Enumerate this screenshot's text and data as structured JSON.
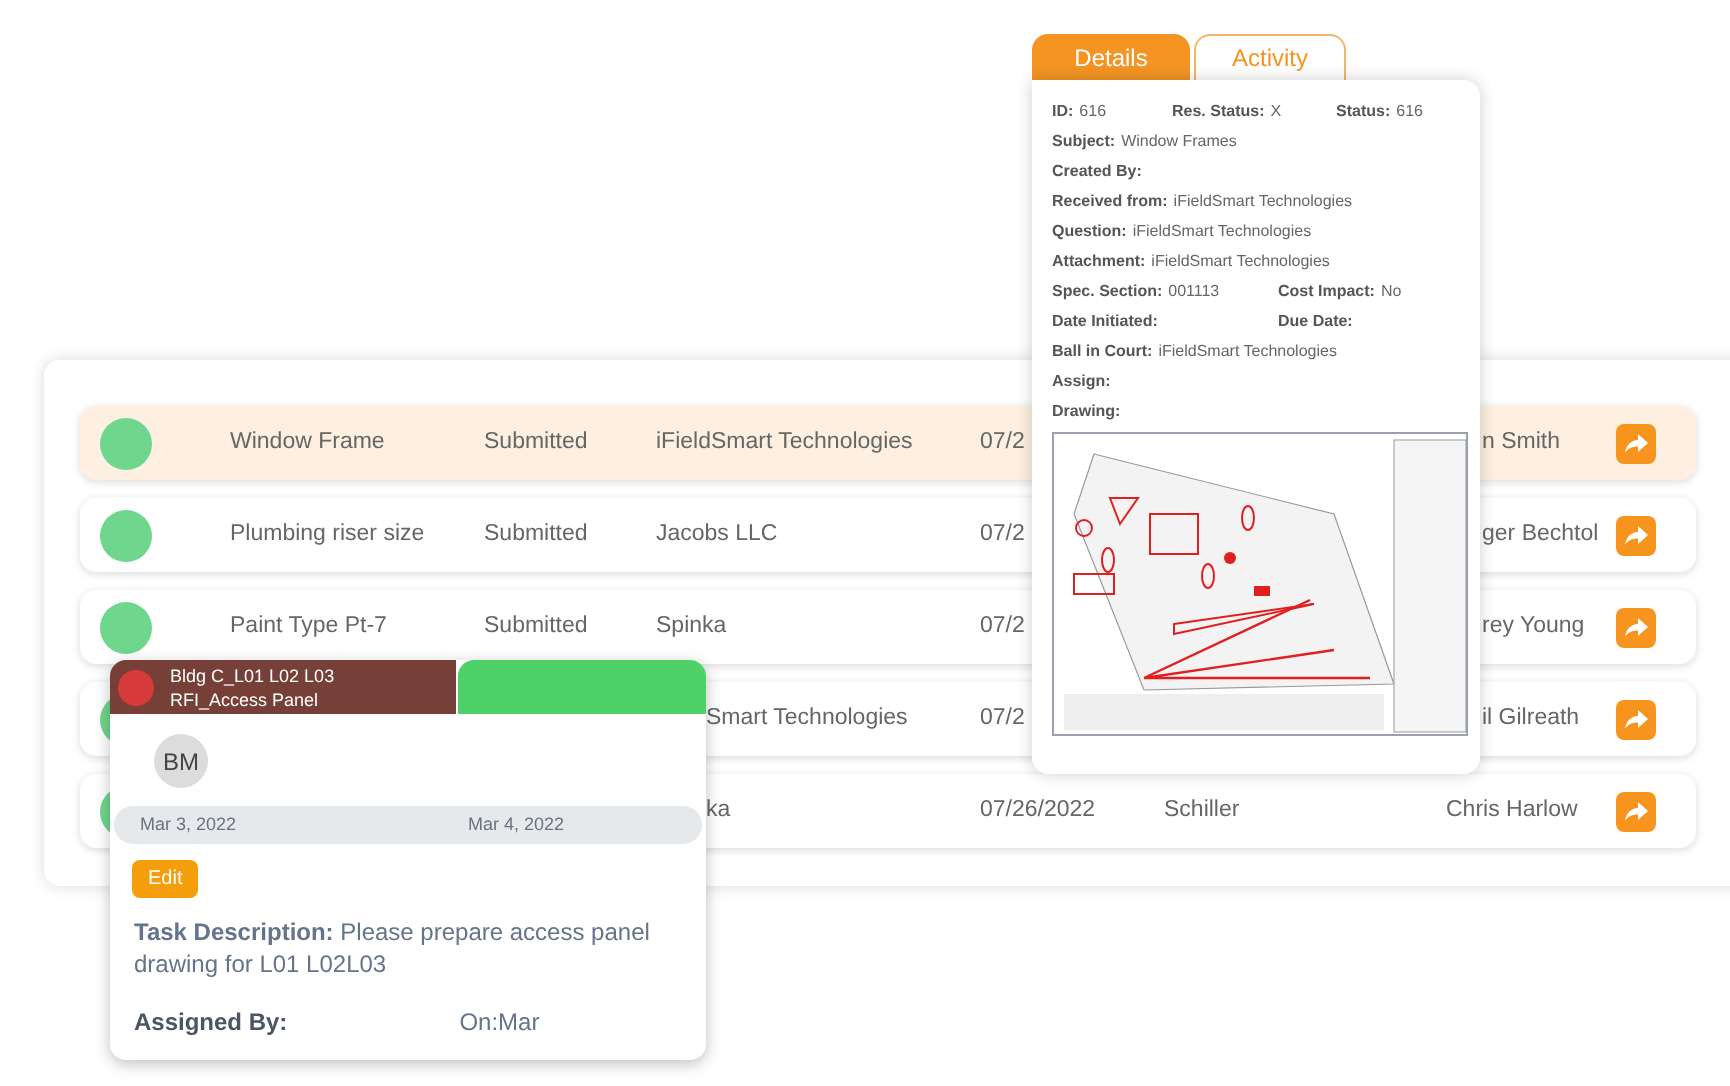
{
  "rows": [
    {
      "highlighted": true,
      "subject": {
        "text": "Window Frame"
      },
      "status": {
        "text": "Submitted"
      },
      "company": {
        "text": "iFieldSmart Technologies"
      },
      "date": {
        "text": "07/2"
      },
      "person": {
        "text": "n Smith",
        "cut_start": true
      }
    },
    {
      "highlighted": false,
      "subject": {
        "text": "Plumbing riser size"
      },
      "status": {
        "text": "Submitted"
      },
      "company": {
        "text": "Jacobs LLC"
      },
      "date": {
        "text": "07/2"
      },
      "person": {
        "text": "ger Bechtol",
        "cut_start": true
      }
    },
    {
      "highlighted": false,
      "subject": {
        "text": "Paint Type Pt-7"
      },
      "status": {
        "text": "Submitted"
      },
      "company": {
        "text": "Spinka"
      },
      "date": {
        "text": "07/2"
      },
      "person": {
        "text": "rey Young",
        "cut_start": true
      }
    },
    {
      "highlighted": false,
      "company": {
        "text": "Smart Technologies",
        "cut_start": true
      },
      "date": {
        "text": "07/2"
      },
      "person": {
        "text": "il Gilreath",
        "cut_start": true
      }
    },
    {
      "highlighted": false,
      "company": {
        "text": "ka",
        "cut_start": true
      },
      "date": {
        "text": "07/26/2022"
      },
      "column_5": {
        "text": "Schiller"
      },
      "person": {
        "text": "Chris Harlow"
      }
    }
  ],
  "details_popup": {
    "tabs": [
      {
        "label": "Details",
        "selected": true
      },
      {
        "label": "Activity",
        "selected": false
      }
    ],
    "fields": [
      [
        {
          "label": "ID:",
          "value": "616"
        },
        {
          "label": "Res. Status:",
          "value": "X"
        },
        {
          "label": "Status:",
          "value": "616"
        }
      ],
      [
        {
          "label": "Subject:",
          "value": "Window Frames"
        }
      ],
      [
        {
          "label": "Created By:"
        }
      ],
      [
        {
          "label": "Received from:",
          "value": "iFieldSmart Technologies"
        }
      ],
      [
        {
          "label": "Question:",
          "value": "iFieldSmart Technologies"
        }
      ],
      [
        {
          "label": "Attachment:",
          "value": "iFieldSmart Technologies"
        }
      ],
      [
        {
          "label": "Spec. Section:",
          "value": "001113"
        },
        {
          "label": "Cost Impact:",
          "value": "No"
        }
      ],
      [
        {
          "label": "Date Initiated:"
        },
        {
          "label": "Due Date:"
        }
      ],
      [
        {
          "label": "Ball in Court:",
          "value": "iFieldSmart Technologies"
        }
      ],
      [
        {
          "label": "Assign:"
        }
      ],
      [
        {
          "label": "Drawing:"
        }
      ]
    ],
    "drawing": {
      "kind": "picture"
    }
  },
  "task_card": {
    "title_lines": [
      "Bldg C_L01 L02 L03",
      "RFI_Access Panel"
    ],
    "color": "#d63a3a",
    "avatar": "BM",
    "start_date": "Mar 3, 2022",
    "end_date": "Mar 4, 2022",
    "edit_button": "Edit",
    "description": "**Task Description:** Please prepare access panel drawing for L01 L02L03",
    "assigned_label": "Assigned By:",
    "assigned_on": "On:Mar"
  }
}
